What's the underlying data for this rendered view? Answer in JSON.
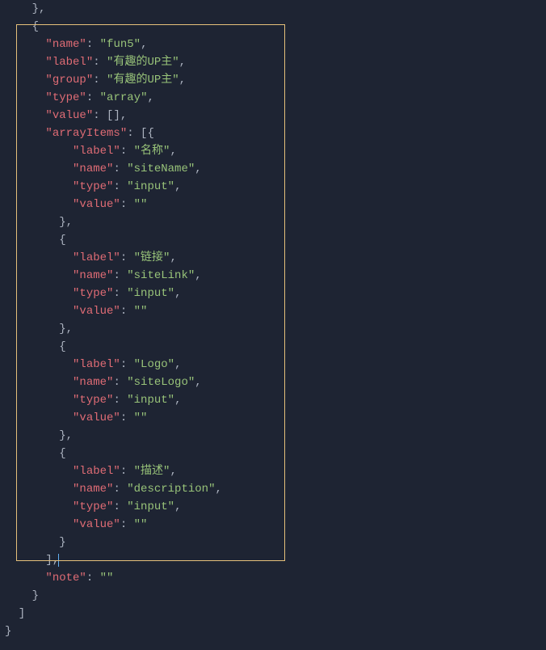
{
  "code": {
    "l1": "    },",
    "l2": "    {",
    "l3a": "      ",
    "l3k": "\"name\"",
    "l3p": ": ",
    "l3v": "\"fun5\"",
    "l3e": ",",
    "l4a": "      ",
    "l4k": "\"label\"",
    "l4p": ": ",
    "l4v": "\"有趣的UP主\"",
    "l4e": ",",
    "l5a": "      ",
    "l5k": "\"group\"",
    "l5p": ": ",
    "l5v": "\"有趣的UP主\"",
    "l5e": ",",
    "l6a": "      ",
    "l6k": "\"type\"",
    "l6p": ": ",
    "l6v": "\"array\"",
    "l6e": ",",
    "l7a": "      ",
    "l7k": "\"value\"",
    "l7p": ": [],",
    "l8a": "      ",
    "l8k": "\"arrayItems\"",
    "l8p": ": [{",
    "l9a": "          ",
    "l9k": "\"label\"",
    "l9p": ": ",
    "l9v": "\"名称\"",
    "l9e": ",",
    "l10a": "          ",
    "l10k": "\"name\"",
    "l10p": ": ",
    "l10v": "\"siteName\"",
    "l10e": ",",
    "l11a": "          ",
    "l11k": "\"type\"",
    "l11p": ": ",
    "l11v": "\"input\"",
    "l11e": ",",
    "l12a": "          ",
    "l12k": "\"value\"",
    "l12p": ": ",
    "l12v": "\"\"",
    "l13": "        },",
    "l14": "        {",
    "l15a": "          ",
    "l15k": "\"label\"",
    "l15p": ": ",
    "l15v": "\"链接\"",
    "l15e": ",",
    "l16a": "          ",
    "l16k": "\"name\"",
    "l16p": ": ",
    "l16v": "\"siteLink\"",
    "l16e": ",",
    "l17a": "          ",
    "l17k": "\"type\"",
    "l17p": ": ",
    "l17v": "\"input\"",
    "l17e": ",",
    "l18a": "          ",
    "l18k": "\"value\"",
    "l18p": ": ",
    "l18v": "\"\"",
    "l19": "        },",
    "l20": "        {",
    "l21a": "          ",
    "l21k": "\"label\"",
    "l21p": ": ",
    "l21v": "\"Logo\"",
    "l21e": ",",
    "l22a": "          ",
    "l22k": "\"name\"",
    "l22p": ": ",
    "l22v": "\"siteLogo\"",
    "l22e": ",",
    "l23a": "          ",
    "l23k": "\"type\"",
    "l23p": ": ",
    "l23v": "\"input\"",
    "l23e": ",",
    "l24a": "          ",
    "l24k": "\"value\"",
    "l24p": ": ",
    "l24v": "\"\"",
    "l25": "        },",
    "l26": "        {",
    "l27a": "          ",
    "l27k": "\"label\"",
    "l27p": ": ",
    "l27v": "\"描述\"",
    "l27e": ",",
    "l28a": "          ",
    "l28k": "\"name\"",
    "l28p": ": ",
    "l28v": "\"description\"",
    "l28e": ",",
    "l29a": "          ",
    "l29k": "\"type\"",
    "l29p": ": ",
    "l29v": "\"input\"",
    "l29e": ",",
    "l30a": "          ",
    "l30k": "\"value\"",
    "l30p": ": ",
    "l30v": "\"\"",
    "l31": "        }",
    "l32": "      ],",
    "l33a": "      ",
    "l33k": "\"note\"",
    "l33p": ": ",
    "l33v": "\"\"",
    "l34": "    }",
    "l35": "  ]",
    "l36": "}"
  }
}
